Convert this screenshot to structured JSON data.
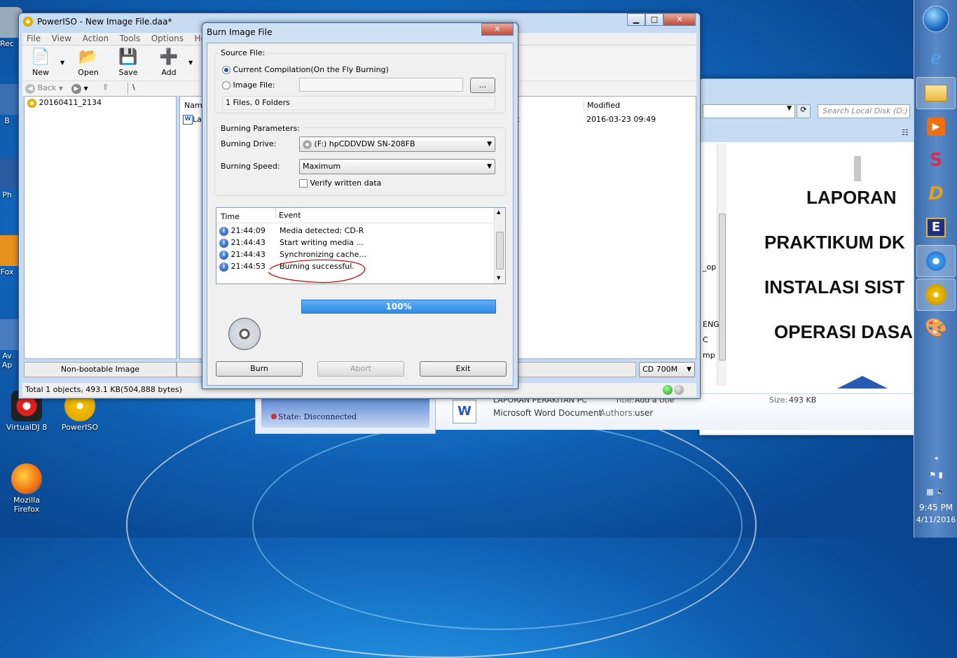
{
  "desktop": {
    "icons": [
      {
        "label": "Rec"
      },
      {
        "label": "B"
      },
      {
        "label": "Ph"
      },
      {
        "label": "Fox"
      },
      {
        "label": "Av\nAp"
      },
      {
        "label": "VirtualDJ 8"
      },
      {
        "label": "PowerISO"
      },
      {
        "label": "Mozilla\nFirefox"
      }
    ]
  },
  "taskbar": {
    "items": [
      "start-orb",
      "internet-explorer-icon",
      "explorer-folder-icon",
      "media-player-icon",
      "swirl-app-icon",
      "d-app-icon",
      "e-app-icon",
      "network-app-icon",
      "poweriso-icon",
      "paint-icon"
    ],
    "time": "9:45 PM",
    "date": "4/11/2016"
  },
  "explorer": {
    "search_placeholder": "Search Local Disk (D:)",
    "doc_lines": [
      "LAPORAN",
      "PRAKTIKUM DK",
      "INSTALASI SIST",
      "OPERASI DASA"
    ],
    "side_text": [
      "_op",
      "ENG",
      "C",
      "mp"
    ],
    "details": {
      "title_partial": "LAPORAN PERAKITAN PC",
      "type": "Microsoft Word Document",
      "title_label": "Title:",
      "title_value": "Add a title",
      "authors_label": "Authors:",
      "authors_value": "user",
      "size_label": "Size:",
      "size_value": "493 KB"
    },
    "state": "State: Disconnected"
  },
  "poweriso": {
    "title": "PowerISO - New Image File.daa*",
    "menu": [
      "File",
      "View",
      "Action",
      "Tools",
      "Options",
      "Help"
    ],
    "toolbar": [
      "New",
      "Open",
      "Save",
      "Add"
    ],
    "nav": {
      "back": "Back",
      "path": "\\"
    },
    "tree_item": "20160411_2134",
    "columns": {
      "name": "Name",
      "modified": "Modified"
    },
    "file": {
      "name_partial": "La",
      "type_partial": "t",
      "modified": "2016-03-23 09:49"
    },
    "bootable": "Non-bootable Image",
    "capacity": "CD 700M",
    "status": "Total 1 objects, 493.1 KB(504,888 bytes)"
  },
  "dialog": {
    "title": "Burn Image File",
    "source_label": "Source File:",
    "radio_current": "Current Compilation(On the Fly Burning)",
    "radio_image": "Image File:",
    "browse": "...",
    "files_info": "1 Files, 0 Folders",
    "params_label": "Burning Parameters:",
    "drive_label": "Burning Drive:",
    "drive_value": "(F:) hpCDDVDW SN-208FB",
    "speed_label": "Burning Speed:",
    "speed_value": "Maximum",
    "verify": "Verify written data",
    "log_headers": [
      "Time",
      "Event"
    ],
    "log": [
      {
        "time": "21:44:09",
        "event": "Media detected: CD-R"
      },
      {
        "time": "21:44:43",
        "event": "Start writing media ..."
      },
      {
        "time": "21:44:43",
        "event": "Synchronizing cache..."
      },
      {
        "time": "21:44:53",
        "event": "Burning successful."
      }
    ],
    "progress_label": "100%",
    "progress": 1.0,
    "buttons": {
      "burn": "Burn",
      "abort": "Abort",
      "exit": "Exit"
    }
  }
}
